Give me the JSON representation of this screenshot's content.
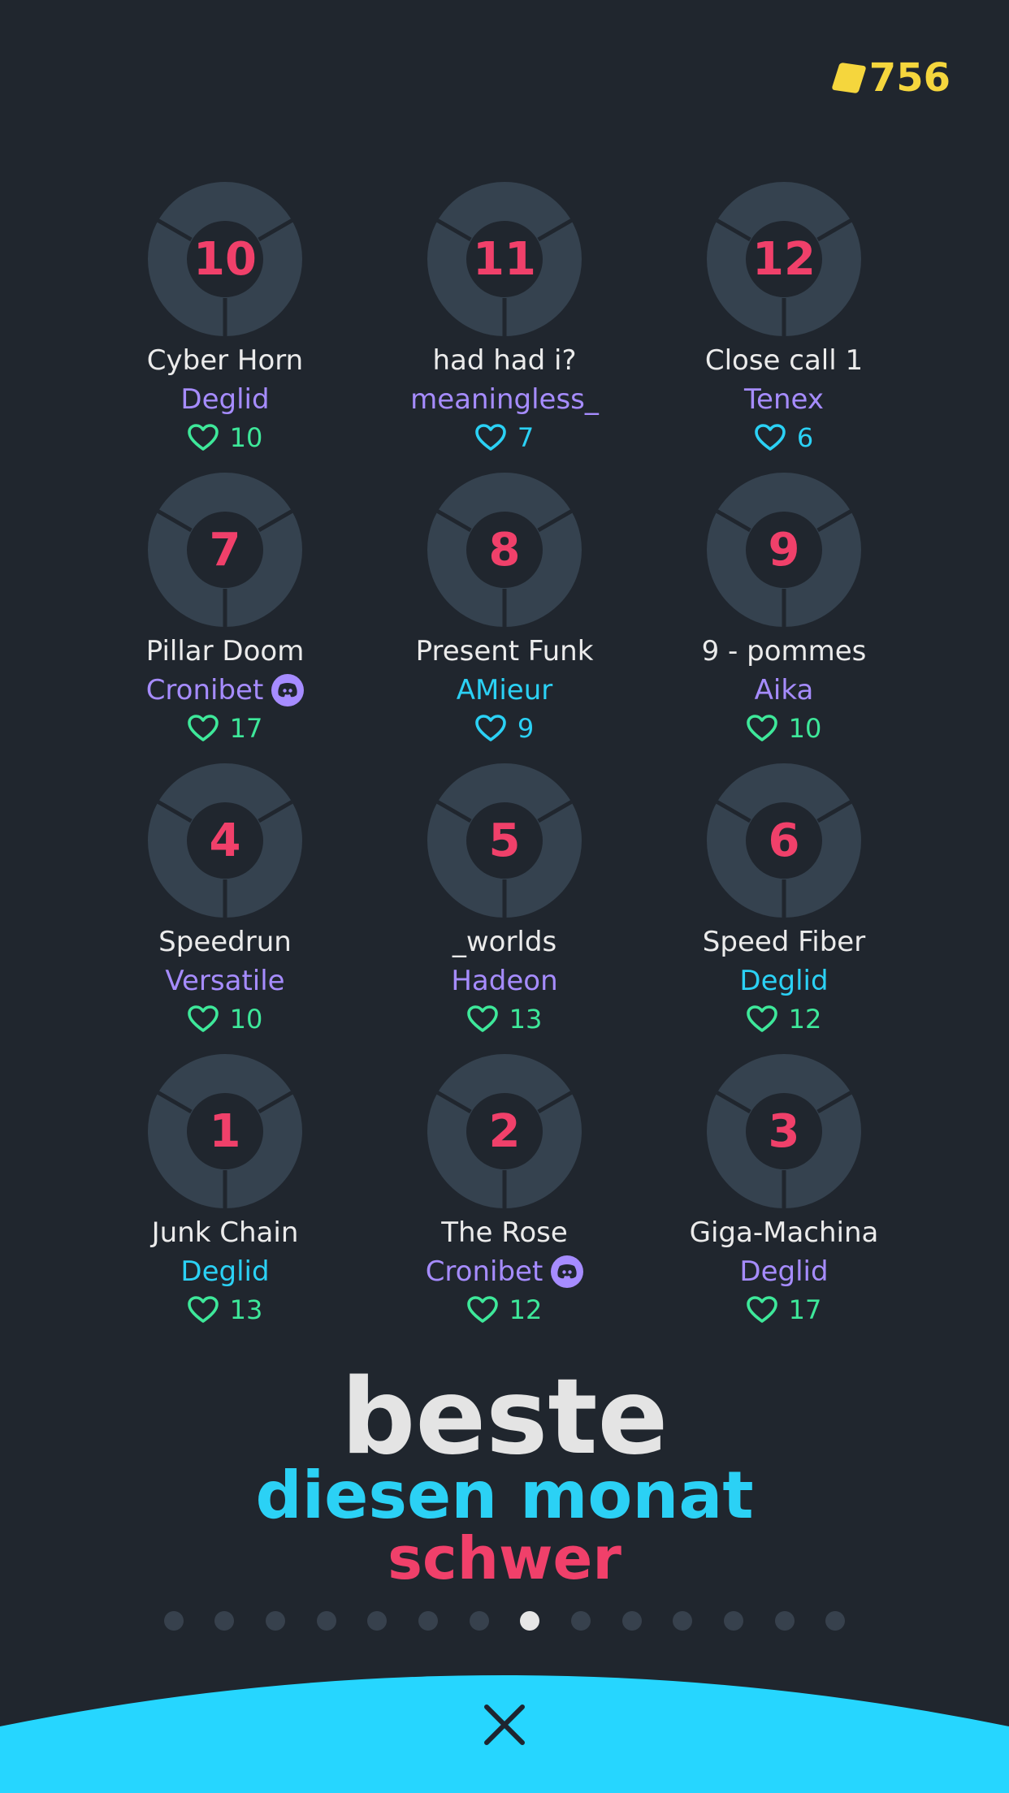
{
  "currency": {
    "amount": "756",
    "icon": "cube-icon",
    "color": "#f5d63d"
  },
  "levels": [
    {
      "number": "10",
      "title": "Cyber Horn",
      "author": "Deglid",
      "author_color": "purple",
      "likes": "10",
      "likes_color": "green",
      "discord": false
    },
    {
      "number": "11",
      "title": "had had i?",
      "author": "meaningless_",
      "author_color": "purple",
      "likes": "7",
      "likes_color": "blue",
      "discord": false
    },
    {
      "number": "12",
      "title": "Close call 1",
      "author": "Tenex",
      "author_color": "purple",
      "likes": "6",
      "likes_color": "blue",
      "discord": false
    },
    {
      "number": "7",
      "title": "Pillar Doom",
      "author": "Cronibet",
      "author_color": "purple",
      "likes": "17",
      "likes_color": "green",
      "discord": true
    },
    {
      "number": "8",
      "title": "Present Funk",
      "author": "AMieur",
      "author_color": "blue",
      "likes": "9",
      "likes_color": "blue",
      "discord": false
    },
    {
      "number": "9",
      "title": "9 - pommes",
      "author": "Aika",
      "author_color": "purple",
      "likes": "10",
      "likes_color": "green",
      "discord": false
    },
    {
      "number": "4",
      "title": "Speedrun",
      "author": "Versatile",
      "author_color": "purple",
      "likes": "10",
      "likes_color": "green",
      "discord": false
    },
    {
      "number": "5",
      "title": "_worlds",
      "author": "Hadeon",
      "author_color": "purple",
      "likes": "13",
      "likes_color": "green",
      "discord": false
    },
    {
      "number": "6",
      "title": "Speed Fiber",
      "author": "Deglid",
      "author_color": "blue",
      "likes": "12",
      "likes_color": "green",
      "discord": false
    },
    {
      "number": "1",
      "title": "Junk Chain",
      "author": "Deglid",
      "author_color": "blue",
      "likes": "13",
      "likes_color": "green",
      "discord": false
    },
    {
      "number": "2",
      "title": "The Rose",
      "author": "Cronibet",
      "author_color": "purple",
      "likes": "12",
      "likes_color": "green",
      "discord": true
    },
    {
      "number": "3",
      "title": "Giga-Machina",
      "author": "Deglid",
      "author_color": "purple",
      "likes": "17",
      "likes_color": "green",
      "discord": false
    }
  ],
  "heading": {
    "sort": "beste",
    "period": "diesen monat",
    "difficulty": "schwer"
  },
  "pagination": {
    "total": 14,
    "active_index": 7
  },
  "close": {
    "icon": "close-icon"
  },
  "colors": {
    "background": "#20262e",
    "accent_blue": "#2bd1f5",
    "accent_pink": "#f0406a",
    "purple": "#a68cff",
    "green": "#3ee89a",
    "yellow": "#f5d63d"
  }
}
